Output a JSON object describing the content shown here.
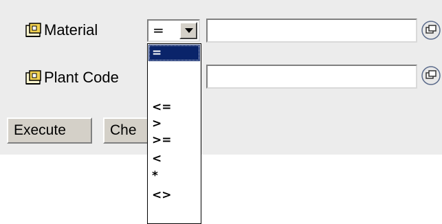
{
  "fields": [
    {
      "label": "Material",
      "operator": "=",
      "value": ""
    },
    {
      "label": "Plant Code",
      "value": ""
    }
  ],
  "buttons": {
    "execute": "Execute",
    "check": "Che"
  },
  "dropdown": {
    "options": [
      "=",
      "",
      "",
      "<=",
      ">",
      ">=",
      "<",
      "*",
      "<>"
    ],
    "selected": "="
  },
  "icons": {
    "field_icon": "info-book-icon",
    "value_help": "value-help-icon",
    "dropdown_arrow": "chevron-down-icon"
  },
  "colors": {
    "selection": "#0a246a",
    "panel": "#ececec",
    "button_face": "#d4d0c8"
  }
}
